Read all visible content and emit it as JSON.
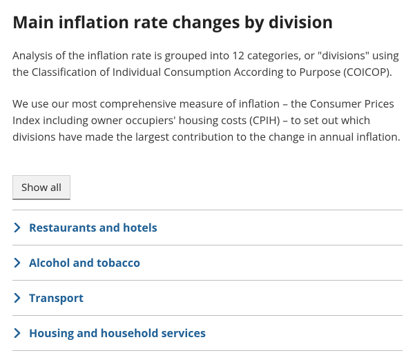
{
  "heading": "Main inflation rate changes by division",
  "paragraph1": "Analysis of the inflation rate is grouped into 12 categories, or \"divisions\" using the Classification of Individual Consumption According to Purpose (COICOP).",
  "paragraph2": "We use our most comprehensive measure of inflation – the Consumer Prices Index including owner occupiers' housing costs (CPIH) – to set out which divisions have made the largest contribution to the change in annual inflation.",
  "show_all_label": "Show all",
  "accordion": {
    "items": [
      {
        "label": "Restaurants and hotels"
      },
      {
        "label": "Alcohol and tobacco"
      },
      {
        "label": "Transport"
      },
      {
        "label": "Housing and household services"
      }
    ]
  },
  "colors": {
    "link": "#206095",
    "border": "#bdbdbd"
  }
}
